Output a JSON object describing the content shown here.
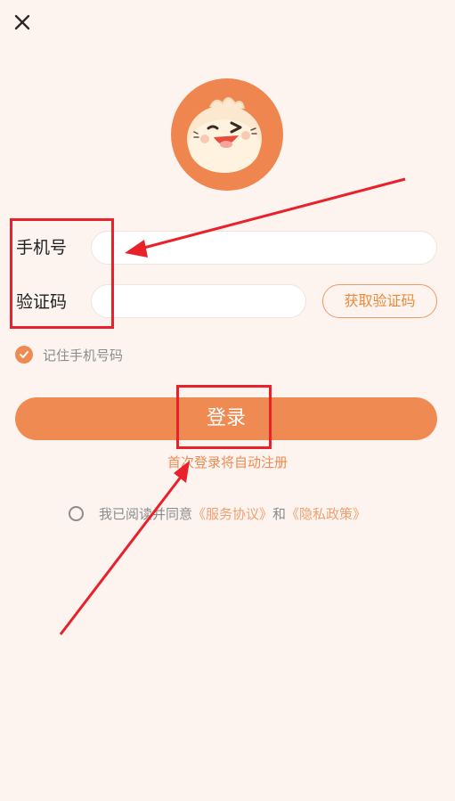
{
  "header": {
    "close_icon": "close-icon"
  },
  "logo": {
    "icon": "steamed-bun-mascot-icon",
    "bg_color": "#f0864f"
  },
  "form": {
    "phone_label": "手机号",
    "phone_value": "",
    "code_label": "验证码",
    "code_value": "",
    "get_code_label": "获取验证码"
  },
  "remember": {
    "label": "记住手机号码",
    "checked": true
  },
  "login": {
    "label": "登录",
    "hint": "首次登录将自动注册"
  },
  "agreement": {
    "prefix": "我已阅读并同意",
    "service_link": "《服务协议》",
    "and": "和",
    "privacy_link": "《隐私政策》",
    "checked": false
  },
  "colors": {
    "accent": "#ef8a52",
    "annotation": "#e8212a",
    "background": "#fdf4ef"
  }
}
